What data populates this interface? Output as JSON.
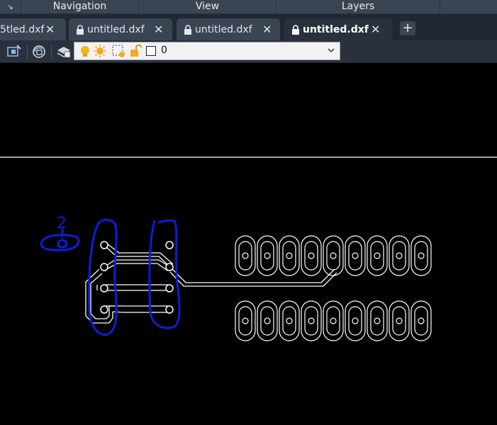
{
  "ribbon": {
    "panel_titles": [
      "Navigation",
      "View",
      "Layers"
    ]
  },
  "tabs": [
    {
      "label": "5tled.dxf",
      "locked": false,
      "active": false
    },
    {
      "label": "untitled.dxf",
      "locked": true,
      "active": false
    },
    {
      "label": "untitled.dxf",
      "locked": true,
      "active": false
    },
    {
      "label": "untitled.dxf",
      "locked": true,
      "active": true
    }
  ],
  "tab_close_glyph": "✕",
  "new_tab_glyph": "+",
  "layer_control": {
    "current_layer": "0",
    "state_icons": [
      "layer-on-icon",
      "layer-thaw-icon",
      "layer-viewport-freeze-icon",
      "layer-unlock-icon"
    ]
  },
  "annotation": {
    "handwritten_number": "2"
  },
  "colors": {
    "ribbon": "#3b4453",
    "tabbar": "#1f2834",
    "toolbar": "#2a313c",
    "canvas": "#000000",
    "drawing_lines": "#ffffff",
    "markup_ink": "#0a1fd6"
  }
}
